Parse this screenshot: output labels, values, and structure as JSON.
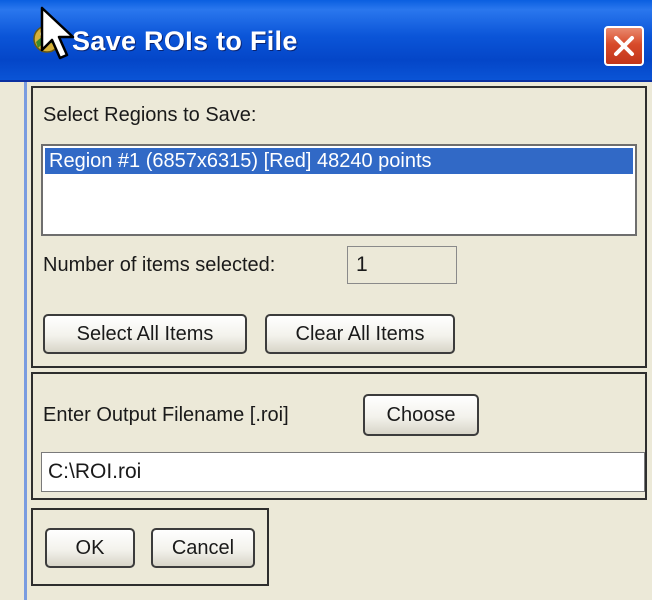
{
  "window": {
    "title": "Save ROIs to File",
    "accent": "#0b55d8"
  },
  "regions": {
    "label": "Select Regions to Save:",
    "items": [
      {
        "label": "Region #1 (6857x6315) [Red] 48240 points",
        "selected": true
      }
    ],
    "selected_color": "#3169c6",
    "count_label": "Number of items selected:",
    "count_value": "1",
    "select_all_label": "Select All Items",
    "clear_all_label": "Clear All Items"
  },
  "output": {
    "label": "Enter Output Filename [.roi]",
    "choose_label": "Choose",
    "filename": "C:\\ROI.roi"
  },
  "actions": {
    "ok_label": "OK",
    "cancel_label": "Cancel"
  },
  "icons": [
    "app-icon",
    "close-icon",
    "mouse-cursor-icon"
  ]
}
